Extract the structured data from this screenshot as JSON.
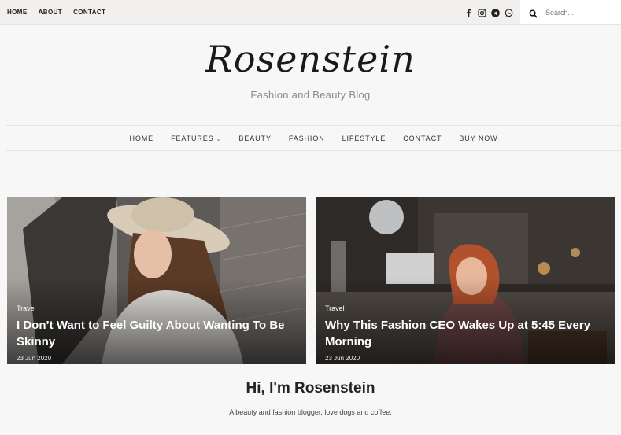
{
  "topnav": [
    "HOME",
    "ABOUT",
    "CONTACT"
  ],
  "social_icons": [
    "facebook-icon",
    "instagram-icon",
    "telegram-icon",
    "whatsapp-icon"
  ],
  "search": {
    "placeholder": "Search..."
  },
  "site": {
    "logo": "Rosenstein",
    "tagline": "Fashion and Beauty Blog"
  },
  "mainnav": {
    "home": "HOME",
    "features": "FEATURES",
    "beauty": "BEAUTY",
    "fashion": "FASHION",
    "lifestyle": "LIFESTYLE",
    "contact": "CONTACT",
    "buy": "BUY NOW"
  },
  "featured": [
    {
      "category": "Travel",
      "title": "I Don’t Want to Feel Guilty About Wanting To Be Skinny",
      "date": "23 Jun 2020"
    },
    {
      "category": "Travel",
      "title": "Why This Fashion CEO Wakes Up at 5:45 Every Morning",
      "date": "23 Jun 2020"
    }
  ],
  "about": {
    "title": "Hi, I'm Rosenstein",
    "text": "A beauty and fashion blogger, love dogs and coffee."
  },
  "colors": {
    "topbar_bg": "#f2f0ee",
    "page_bg": "#f7f7f7",
    "text_dark": "#222222"
  }
}
